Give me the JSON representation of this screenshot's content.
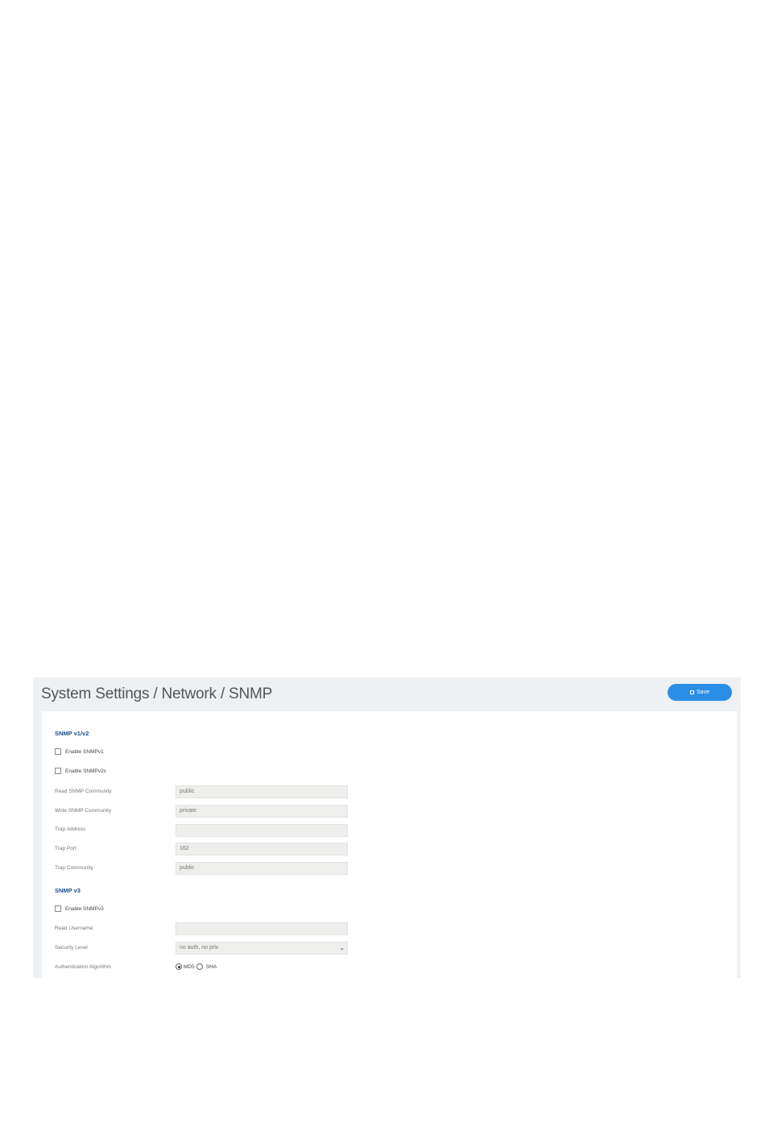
{
  "header": {
    "title": "System Settings / Network / SNMP",
    "save_label": "Save"
  },
  "snmp_v1v2": {
    "heading": "SNMP v1/v2",
    "enable_v1": "Enable SNMPv1",
    "enable_v2c": "Enable SNMPv2c",
    "read_community_label": "Read SNMP Community",
    "read_community_value": "public",
    "write_community_label": "Write SNMP Community",
    "write_community_value": "private",
    "trap_address_label": "Trap Address",
    "trap_address_value": "",
    "trap_port_label": "Trap Port",
    "trap_port_value": "162",
    "trap_community_label": "Trap Community",
    "trap_community_value": "public"
  },
  "snmp_v3": {
    "heading": "SNMP v3",
    "enable_v3": "Enable SNMPv3",
    "read_username_label": "Read Username",
    "read_username_value": "",
    "security_level_label": "Security Level",
    "security_level_value": "no auth, no priv",
    "auth_algorithm_label": "Authentication Algorithm",
    "auth_options": [
      "MD5",
      "SHA"
    ],
    "auth_selected": "MD5"
  }
}
